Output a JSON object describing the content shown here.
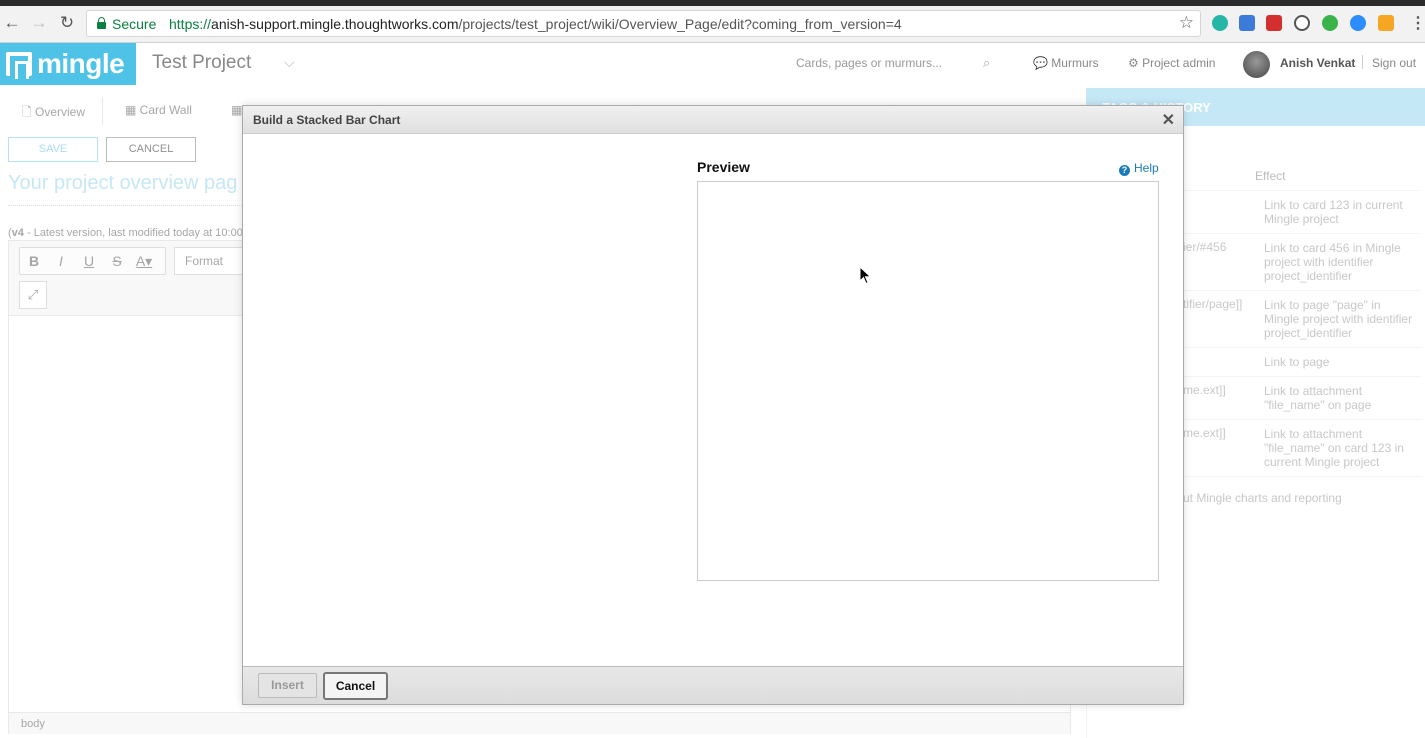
{
  "browser": {
    "secure_label": "Secure",
    "url_proto": "https://",
    "url_host": "anish-support.mingle.thoughtworks.com",
    "url_path": "/projects/test_project/wiki/Overview_Page/edit?coming_from_version=4"
  },
  "header": {
    "logo_text": "mingle",
    "project_name": "Test Project",
    "search_placeholder": "Cards, pages or murmurs...",
    "murmurs": "Murmurs",
    "project_admin": "Project admin",
    "user_name": "Anish Venkat",
    "sign_out": "Sign out"
  },
  "tabs": {
    "overview": "Overview",
    "card_wall": "Card Wall"
  },
  "editor": {
    "save_label": "SAVE",
    "cancel_label": "CANCEL",
    "page_title": "Your project overview pag",
    "version_prefix": "(",
    "version_number": "v4",
    "version_text": " - Latest version, last modified today at 10:00",
    "format_label": "Format",
    "status_path": "body"
  },
  "right_panel": {
    "heading": "TAGS & HISTORY",
    "col_effect": "Effect",
    "rows": [
      {
        "syntax": "",
        "effect": "Link to card 123 in current Mingle project"
      },
      {
        "syntax": "ier/#456",
        "effect": "Link to card 456 in Mingle project with identifier project_identifier"
      },
      {
        "syntax": "tifier/page]]",
        "effect": "Link to page \"page\" in Mingle project with identifier project_identifier"
      },
      {
        "syntax": "",
        "effect": "Link to page"
      },
      {
        "syntax": "me.ext]]",
        "effect": "Link to attachment \"file_name\" on page"
      },
      {
        "syntax": "me.ext]]",
        "effect": "Link to attachment \"file_name\" on card 123 in current Mingle project"
      }
    ],
    "footer_text": "ut Mingle charts and reporting"
  },
  "modal": {
    "title": "Build a Stacked Bar Chart",
    "preview_label": "Preview",
    "help_label": "Help",
    "insert_label": "Insert",
    "cancel_label": "Cancel"
  },
  "colors": {
    "brand": "#4fc3e7",
    "help_link": "#1a7bb8"
  }
}
